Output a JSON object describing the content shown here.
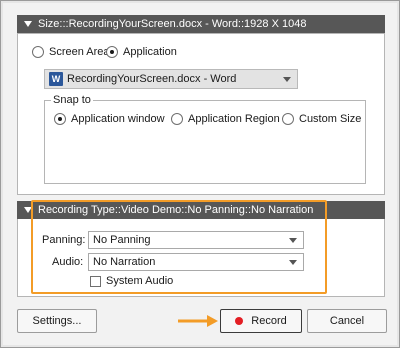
{
  "size_section": {
    "header": "Size:::RecordingYourScreen.docx - Word::1928 X 1048",
    "mode_options": [
      {
        "label": "Screen Area",
        "selected": false
      },
      {
        "label": "Application",
        "selected": true
      }
    ],
    "app_select": {
      "icon": "word-icon",
      "icon_glyph": "W",
      "value": "RecordingYourScreen.docx - Word"
    },
    "snap": {
      "legend": "Snap to",
      "options": [
        {
          "label": "Application window",
          "selected": true
        },
        {
          "label": "Application Region",
          "selected": false
        },
        {
          "label": "Custom Size",
          "selected": false
        }
      ]
    }
  },
  "recording_section": {
    "header": "Recording Type::Video Demo::No Panning::No Narration",
    "panning": {
      "label": "Panning:",
      "value": "No Panning"
    },
    "audio": {
      "label": "Audio:",
      "value": "No Narration"
    },
    "system_audio": {
      "label": "System Audio",
      "checked": false
    },
    "highlight_color": "#f39c27"
  },
  "footer": {
    "settings_label": "Settings...",
    "record_label": "Record",
    "cancel_label": "Cancel",
    "record_dot_color": "#e31e24",
    "arrow_color": "#f39c27"
  }
}
